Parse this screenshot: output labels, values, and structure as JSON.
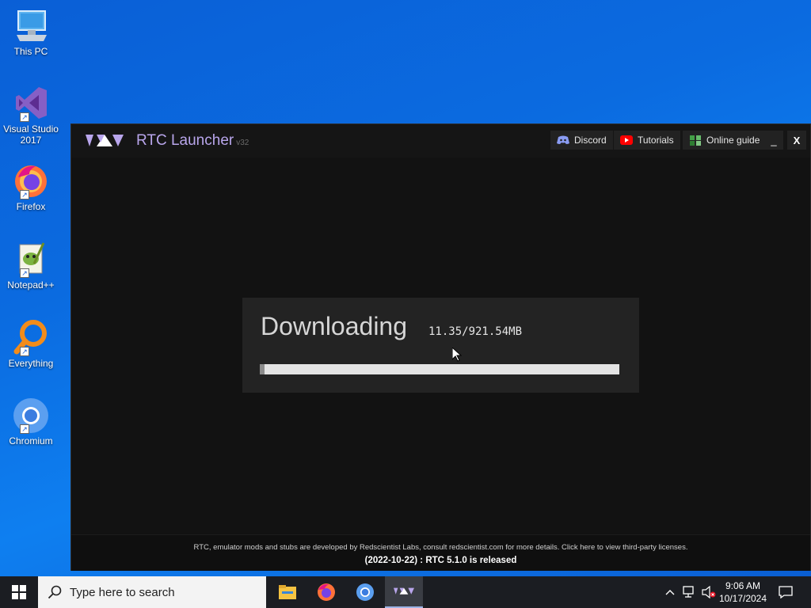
{
  "desktop": {
    "icons": [
      {
        "label": "This PC",
        "icon": "computer-icon"
      },
      {
        "label": "Visual Studio 2017",
        "icon": "visual-studio-icon"
      },
      {
        "label": "Firefox",
        "icon": "firefox-icon"
      },
      {
        "label": "Notepad++",
        "icon": "notepadpp-icon"
      },
      {
        "label": "Everything",
        "icon": "search-magnifier-icon"
      },
      {
        "label": "Chromium",
        "icon": "chromium-icon"
      }
    ]
  },
  "window": {
    "title": "RTC Launcher",
    "version": "v32",
    "buttons": {
      "discord": "Discord",
      "tutorials": "Tutorials",
      "online_guide": "Online guide"
    },
    "controls": {
      "minimize": "_",
      "close": "X"
    },
    "download": {
      "title": "Downloading",
      "size": "11.35/921.54MB",
      "progress_fraction": 0.0123
    },
    "footer": {
      "note": "RTC, emulator mods and stubs are developed by Redscientist Labs, consult redscientist.com for more details. Click here to view third-party licenses.",
      "news": "(2022-10-22) : RTC 5.1.0 is released"
    }
  },
  "taskbar": {
    "search_placeholder": "Type here to search",
    "apps": [
      "file-explorer-icon",
      "firefox-icon",
      "chromium-icon",
      "rtc-launcher-icon"
    ],
    "clock": {
      "time": "9:06 AM",
      "date": "10/17/2024"
    }
  },
  "colors": {
    "accent": "#b9a6ec",
    "window_bg": "#121212",
    "panel_bg": "#232323",
    "desktop_blue": "#0b6be0"
  }
}
